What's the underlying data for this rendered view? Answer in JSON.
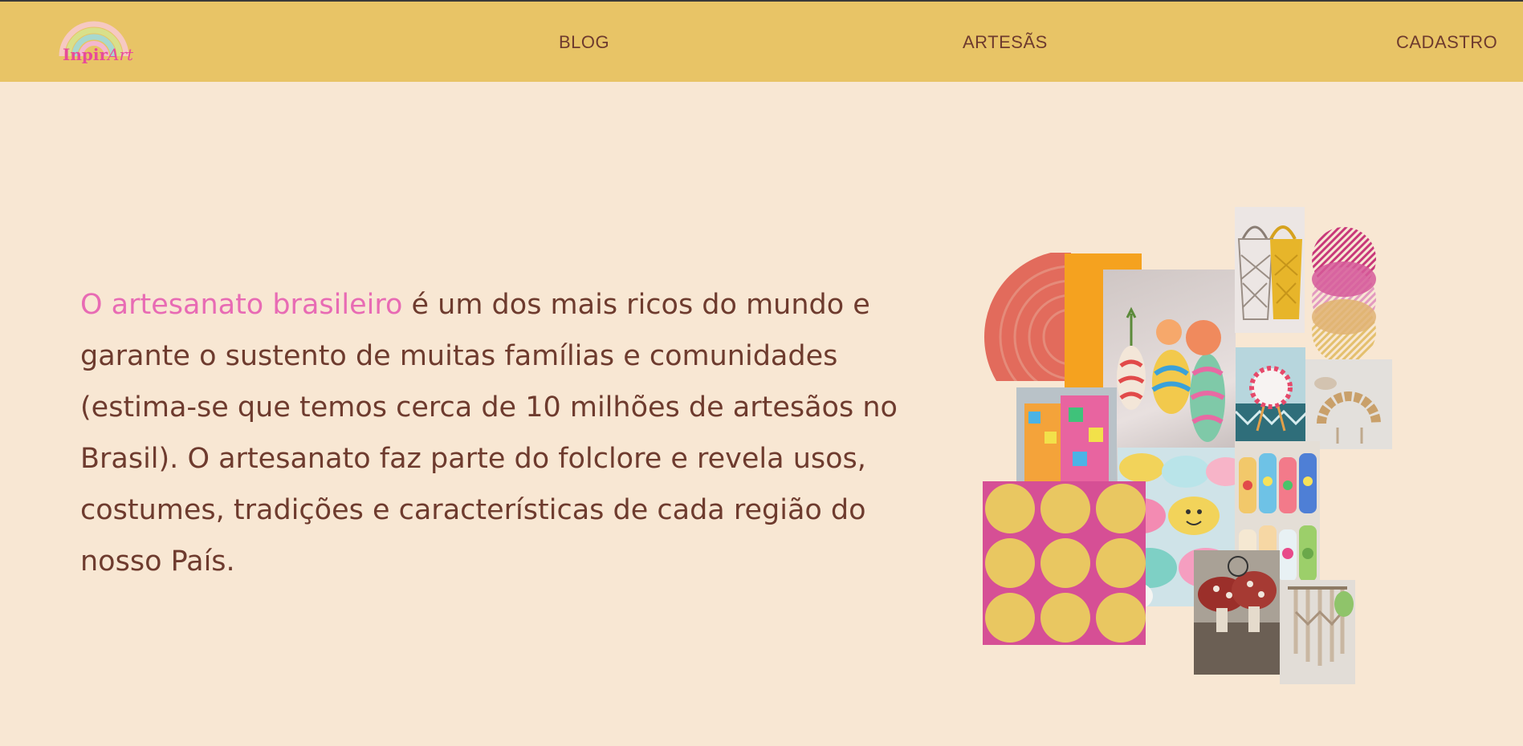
{
  "brand": {
    "logo_primary": "Inpir",
    "logo_accent": "Art",
    "colors": {
      "nav_bg": "#e8c466",
      "page_bg": "#f8e7d3",
      "text": "#6e3b2e",
      "highlight": "#e86bb4"
    }
  },
  "nav": {
    "blog": "BLOG",
    "artesas": "ARTESÃS",
    "cadastro": "CADASTRO"
  },
  "hero": {
    "highlight": "O artesanato brasileiro",
    "body": " é um dos mais ricos do mundo e garante o sustento de muitas famílias e comunidades (estima-se que temos cerca de 10 milhões de artesãos no Brasil). O artesanato faz parte do folclore e revela usos, costumes, tradições e características de cada região do nosso País."
  },
  "collage": {
    "tiles": [
      "rainbow-arc-art",
      "orange-block",
      "painted-vases-photo",
      "macrame-bags-photo",
      "striped-circles-art",
      "wooden-bead-art-photo",
      "painted-mirror-photo",
      "colorful-stand-photo",
      "smiley-candles-photo",
      "painted-bottles-photo",
      "yellow-dots-pattern",
      "mushroom-embroidery-photo",
      "macrame-hanging-photo"
    ]
  }
}
